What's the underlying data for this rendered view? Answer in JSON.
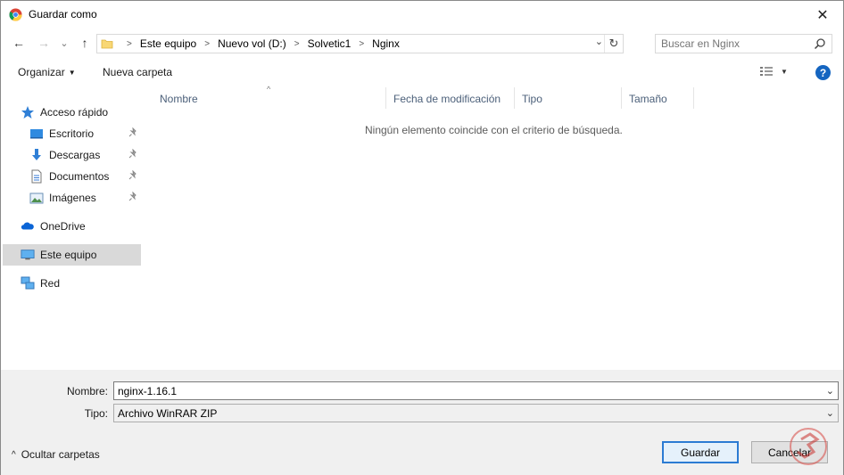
{
  "window": {
    "title": "Guardar como",
    "close_glyph": "✕"
  },
  "nav_buttons": {
    "back": "←",
    "forward": "→",
    "recent": "⌄",
    "up": "↑"
  },
  "address": {
    "crumbs": [
      "Este equipo",
      "Nuevo vol (D:)",
      "Solvetic1",
      "Nginx"
    ],
    "dropdown_glyph": "⌄",
    "refresh_glyph": "↻"
  },
  "search": {
    "placeholder": "Buscar en Nginx"
  },
  "toolbar": {
    "organize_label": "Organizar",
    "new_folder_label": "Nueva carpeta"
  },
  "sidebar": {
    "quick_access": "Acceso rápido",
    "items": [
      {
        "label": "Escritorio",
        "icon": "desktop-icon"
      },
      {
        "label": "Descargas",
        "icon": "download-icon"
      },
      {
        "label": "Documentos",
        "icon": "document-icon"
      },
      {
        "label": "Imágenes",
        "icon": "pictures-icon"
      }
    ],
    "onedrive": "OneDrive",
    "this_pc": "Este equipo",
    "network": "Red"
  },
  "columns": [
    "Nombre",
    "Fecha de modificación",
    "Tipo",
    "Tamaño"
  ],
  "empty_message": "Ningún elemento coincide con el criterio de búsqueda.",
  "form": {
    "name_label": "Nombre:",
    "name_value": "nginx-1.16.1",
    "type_label": "Tipo:",
    "type_value": "Archivo WinRAR ZIP"
  },
  "footer": {
    "hide_folders": "Ocultar carpetas",
    "save": "Guardar",
    "cancel": "Cancelar"
  },
  "colors": {
    "accent": "#2b7bd3",
    "help": "#1565c0",
    "selected": "#d9d9d9",
    "bottom_panel": "#f0f0f0"
  }
}
